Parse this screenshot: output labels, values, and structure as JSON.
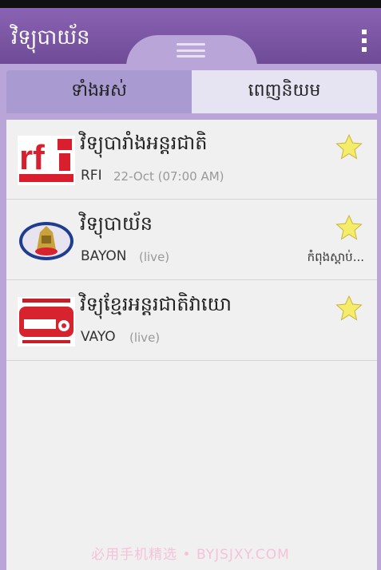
{
  "app": {
    "title": "វិទ្យុបាយ័ន",
    "menu_icon": "overflow-menu-icon",
    "handle_icon": "drag-handle-icon"
  },
  "tabs": [
    {
      "label": "ទាំងអស់",
      "selected": false
    },
    {
      "label": "ពេញនិយម",
      "selected": true
    }
  ],
  "stations": [
    {
      "title": "វិទ្យុបារាំងអន្តរជាតិ",
      "code": "RFI",
      "subtitle": "22-Oct (07:00 AM)",
      "status": "",
      "logo": "rfi-logo",
      "favorite": true
    },
    {
      "title": "វិទ្យុបាយ័ន",
      "code": "BAYON",
      "subtitle": "(live)",
      "status": "កំពុងស្តាប់...",
      "logo": "bayon-logo",
      "favorite": true
    },
    {
      "title": "វិទ្យុខ្មែរអន្តរជាតិវាយោ",
      "code": "VAYO",
      "subtitle": "(live)",
      "status": "",
      "logo": "vayo-logo",
      "favorite": true
    }
  ],
  "watermark": "必用手机精选 • BYJSJXY.COM",
  "colors": {
    "brand": "#7e5aa6",
    "panel": "#b9a5d8",
    "star": "#f5ec6a"
  }
}
